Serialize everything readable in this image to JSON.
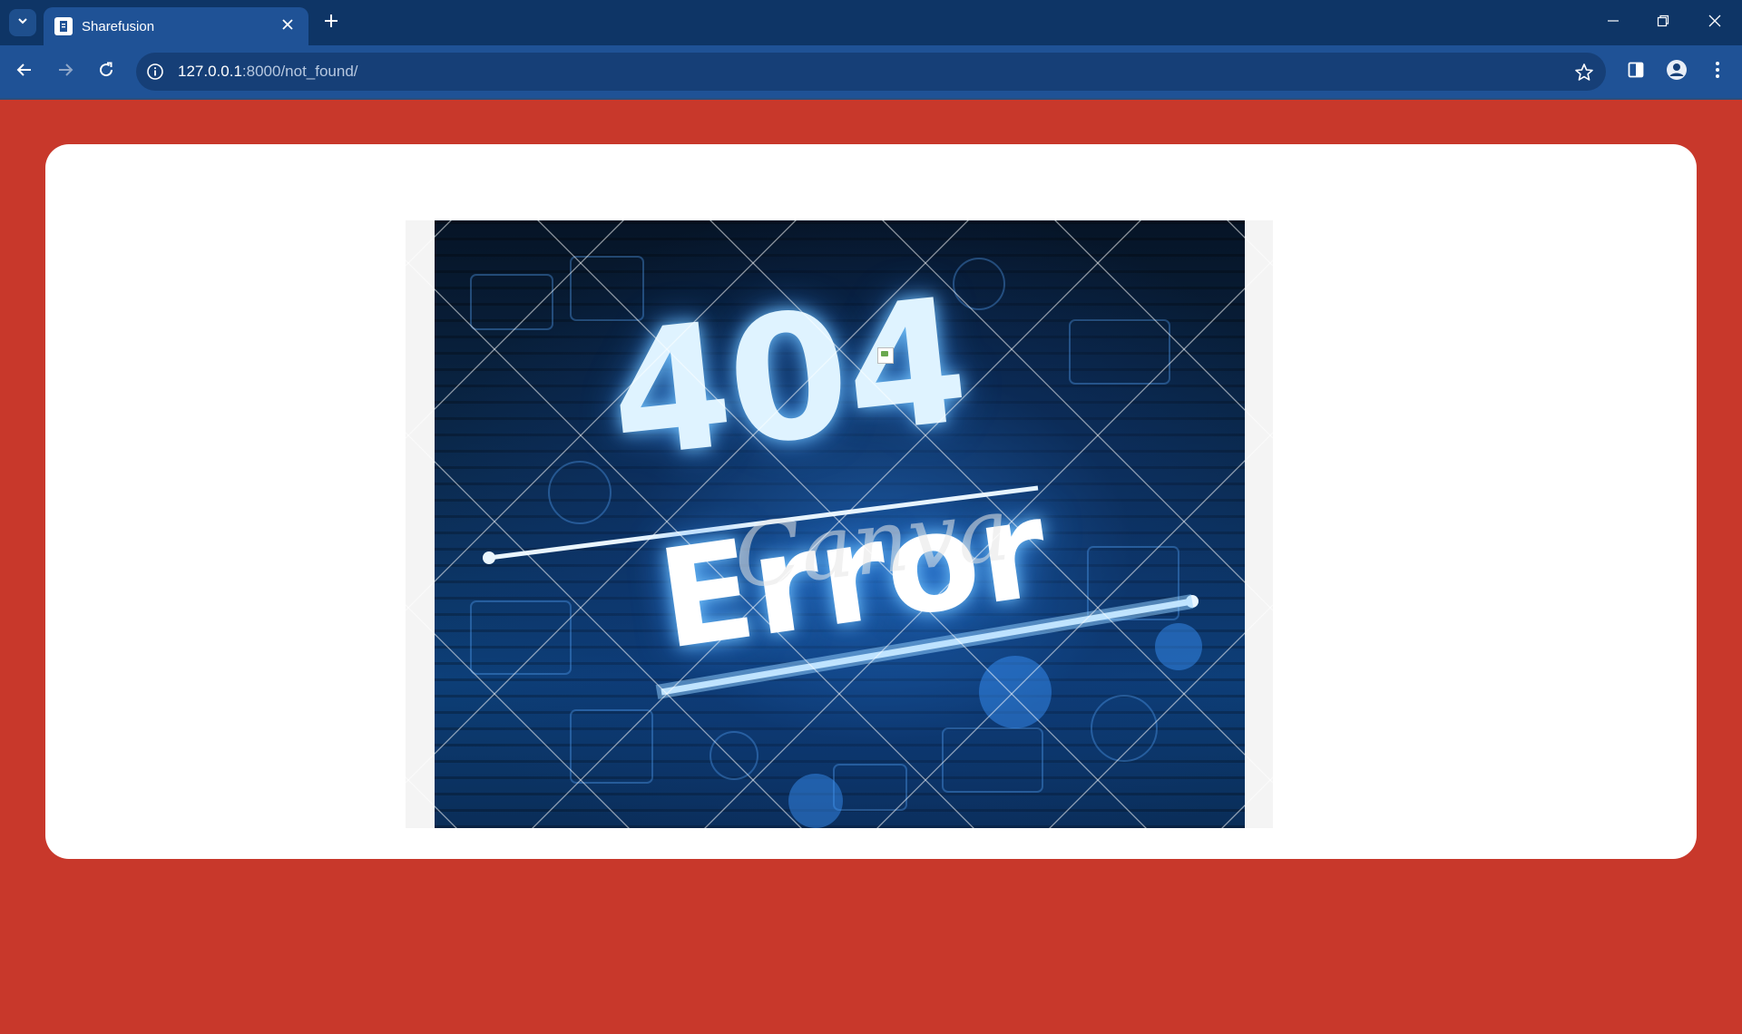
{
  "browser": {
    "tab": {
      "title": "Sharefusion"
    },
    "address": {
      "host": "127.0.0.1",
      "path": ":8000/not_found/"
    },
    "icons": {
      "tab_search": "chevron-down-icon",
      "favicon": "document-icon",
      "tab_close": "close-icon",
      "new_tab": "plus-icon",
      "minimize": "minimize-icon",
      "restore": "restore-icon",
      "close_window": "close-icon",
      "back": "arrow-left-icon",
      "forward": "arrow-right-icon",
      "reload": "reload-icon",
      "site_info": "info-icon",
      "bookmark": "star-icon",
      "side_panel": "side-panel-icon",
      "profile": "profile-icon",
      "menu": "kebab-menu-icon"
    }
  },
  "page": {
    "background_color": "#c8382b",
    "card_color": "#ffffff",
    "error_image": {
      "code_text": "404",
      "word_text": "Error",
      "watermark_text": "Canva"
    }
  }
}
